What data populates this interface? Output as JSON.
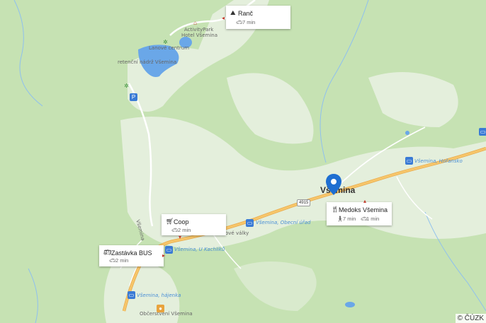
{
  "map": {
    "town_label": "Všemina",
    "road_number": "4915",
    "copyright": "© ČÚZK",
    "place_labels": [
      "ActivityPark",
      "Hotel Všemina",
      "Lanové centrum",
      "retenční nádrž Všemina",
      "ové války",
      "Všemina",
      "Občerstvení Všemina"
    ],
    "stop_labels": [
      "Všemina, Obecní úřad",
      "Všemina, U Kachlíků",
      "Všemina, hájenka",
      "Všemina, Hořansko"
    ],
    "icons": [
      "parking-icon",
      "bus-stop-icon",
      "restaurant-icon",
      "bicycle-icon",
      "location-pin-icon"
    ]
  },
  "cards": [
    {
      "title": "Ranč",
      "icon": "hiking-icon",
      "mode_icon": "car-icon",
      "time": "7 min"
    },
    {
      "title": "Coop",
      "icon": "cart-icon",
      "mode_icon": "car-icon",
      "time": "2 min"
    },
    {
      "title": "Zastávka BUS",
      "icon": "bus-icon",
      "mode_icon": "car-icon",
      "time": "2 min"
    },
    {
      "title": "Medoks Všemina",
      "icon": "restaurant-icon",
      "walk_icon": "walk-icon",
      "walk_time": "7 min",
      "mode_icon": "car-icon",
      "time": "1 min"
    }
  ],
  "colors": {
    "forest": "#b9dca4",
    "meadow": "#e7efe0",
    "road_main": "#f6c66b",
    "water": "#6aa7e8",
    "pin": "#1f6fd1"
  }
}
